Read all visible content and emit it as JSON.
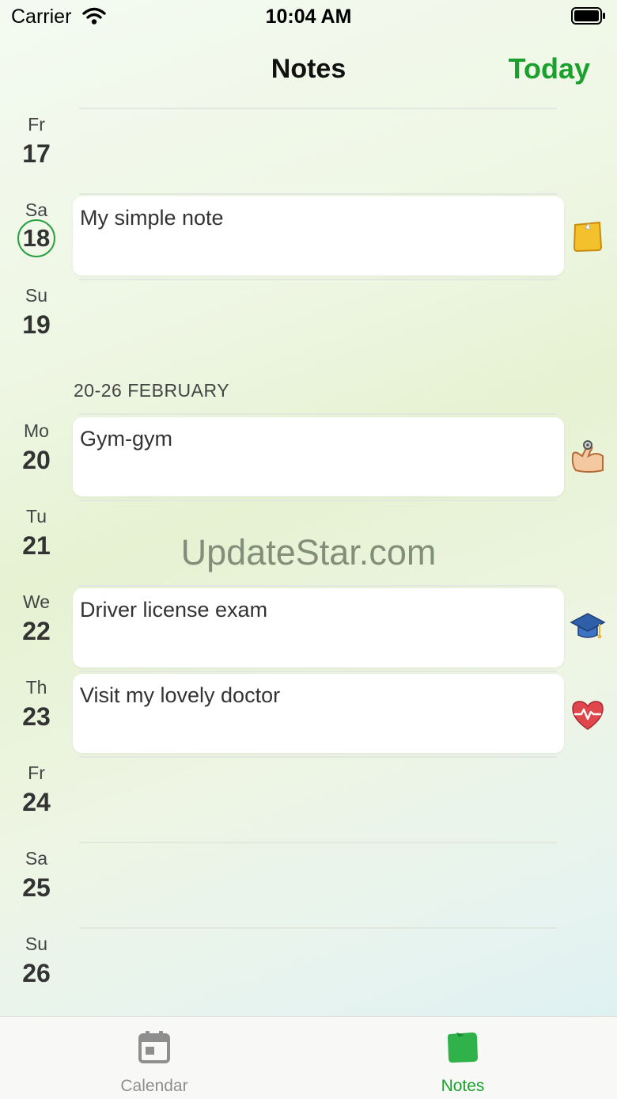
{
  "status_bar": {
    "carrier": "Carrier",
    "time": "10:04 AM"
  },
  "header": {
    "title": "Notes",
    "today_button": "Today"
  },
  "days": [
    {
      "name": "Fr",
      "num": "17"
    },
    {
      "name": "Sa",
      "num": "18",
      "selected": true
    },
    {
      "name": "Su",
      "num": "19"
    },
    {
      "name": "Mo",
      "num": "20"
    },
    {
      "name": "Tu",
      "num": "21"
    },
    {
      "name": "We",
      "num": "22"
    },
    {
      "name": "Th",
      "num": "23"
    },
    {
      "name": "Fr",
      "num": "24"
    },
    {
      "name": "Sa",
      "num": "25"
    },
    {
      "name": "Su",
      "num": "26"
    }
  ],
  "week_header": "20-26 FEBRUARY",
  "notes": [
    {
      "day": "18",
      "text": "My simple note",
      "icon": "sticky-note-icon"
    },
    {
      "day": "20",
      "text": "Gym-gym",
      "icon": "flexed-arm-icon"
    },
    {
      "day": "22",
      "text": "Driver license exam",
      "icon": "graduation-cap-icon"
    },
    {
      "day": "23",
      "text": "Visit my lovely doctor",
      "icon": "heart-pulse-icon"
    }
  ],
  "watermark": "UpdateStar.com",
  "tabs": [
    {
      "label": "Calendar",
      "icon": "calendar-icon",
      "active": false
    },
    {
      "label": "Notes",
      "icon": "notes-icon",
      "active": true
    }
  ],
  "colors": {
    "accent": "#1aa02c",
    "inactive": "#8e8e8e",
    "selected_ring": "#2aa043"
  }
}
